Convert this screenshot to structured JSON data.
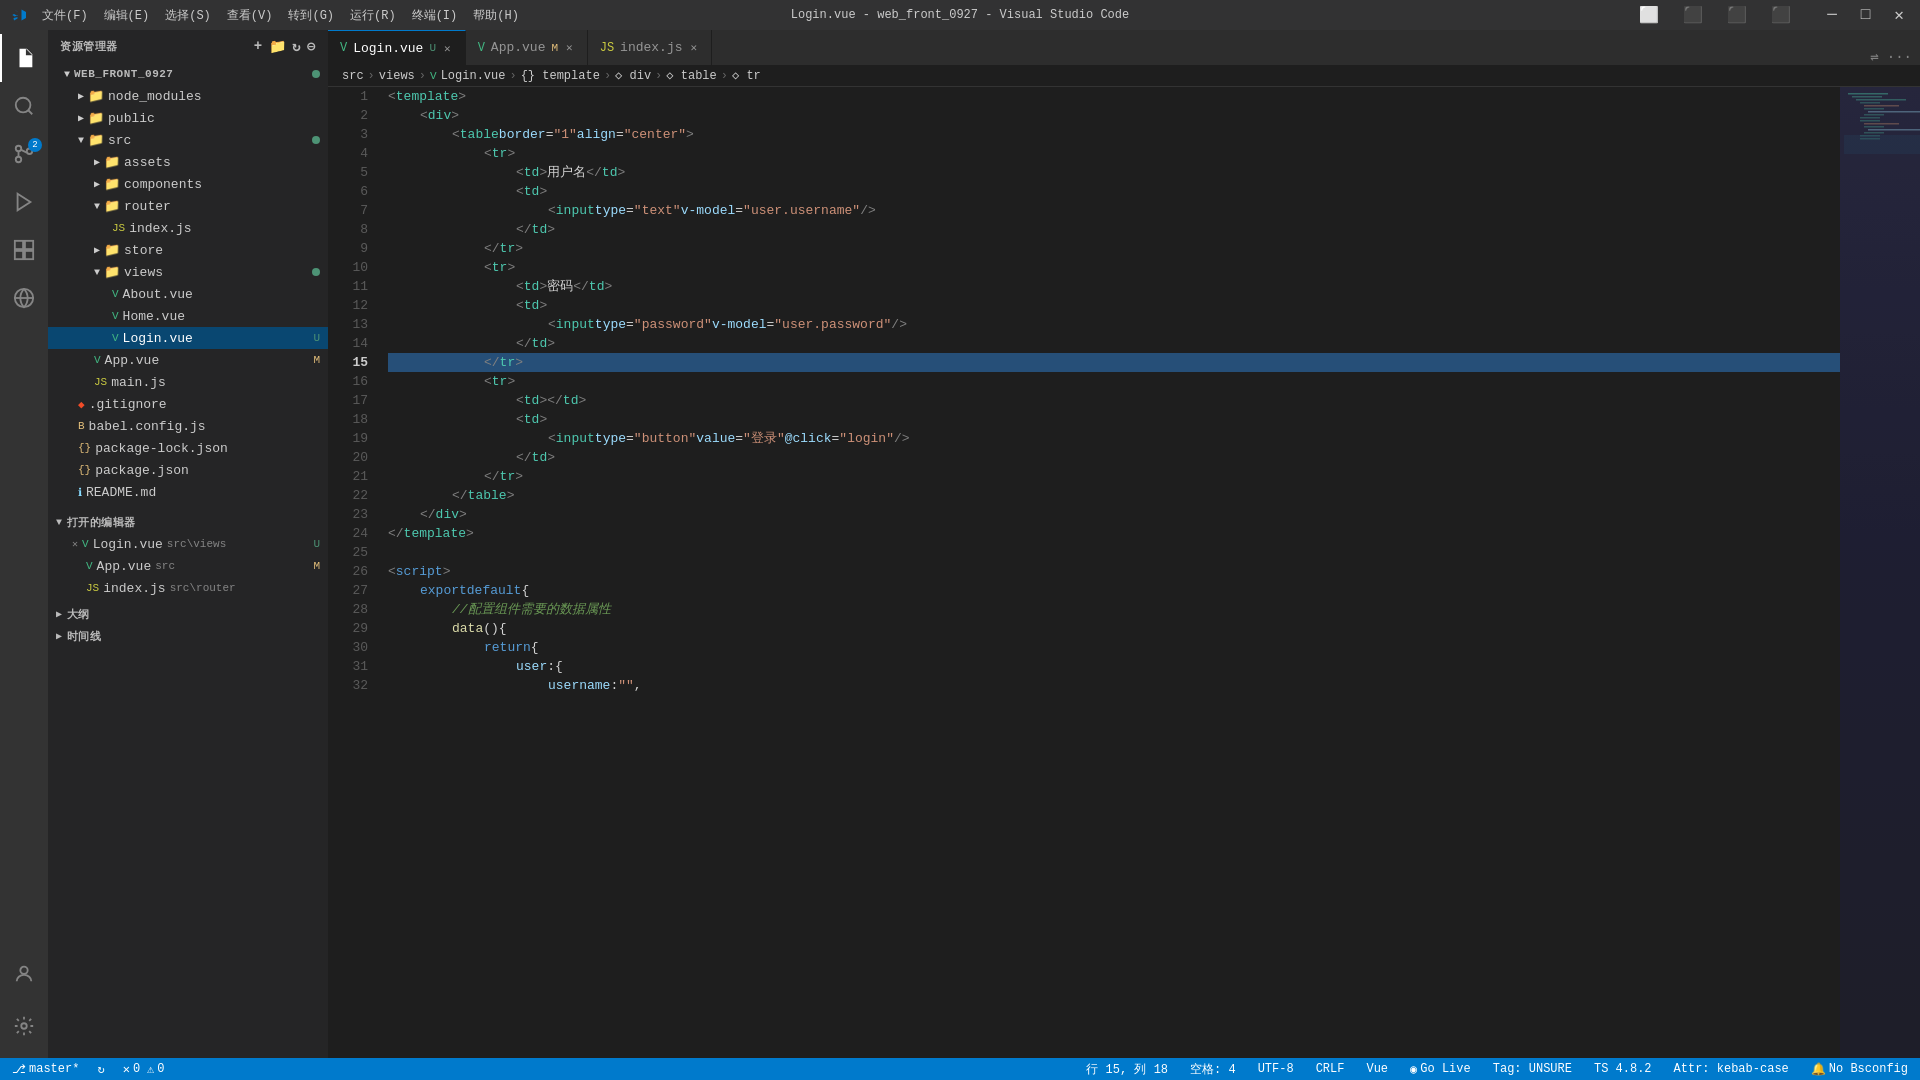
{
  "titleBar": {
    "menuItems": [
      "文件(F)",
      "编辑(E)",
      "选择(S)",
      "查看(V)",
      "转到(G)",
      "运行(R)",
      "终端(I)",
      "帮助(H)"
    ],
    "title": "Login.vue - web_front_0927 - Visual Studio Code"
  },
  "sidebar": {
    "header": "资源管理器",
    "rootName": "WEB_FRONT_0927",
    "openEditors": "打开的编辑器",
    "outline": "大纲",
    "timeline": "时间线",
    "files": [
      {
        "name": "node_modules",
        "type": "folder",
        "indent": 1,
        "collapsed": true
      },
      {
        "name": "public",
        "type": "folder",
        "indent": 1,
        "collapsed": true
      },
      {
        "name": "src",
        "type": "folder",
        "indent": 1,
        "collapsed": false,
        "dot": "modified"
      },
      {
        "name": "assets",
        "type": "folder",
        "indent": 2,
        "collapsed": true
      },
      {
        "name": "components",
        "type": "folder",
        "indent": 2,
        "collapsed": true
      },
      {
        "name": "router",
        "type": "folder",
        "indent": 2,
        "collapsed": false
      },
      {
        "name": "index.js",
        "type": "js",
        "indent": 3
      },
      {
        "name": "store",
        "type": "folder",
        "indent": 2,
        "collapsed": true
      },
      {
        "name": "views",
        "type": "folder",
        "indent": 2,
        "collapsed": false,
        "dot": "modified"
      },
      {
        "name": "About.vue",
        "type": "vue",
        "indent": 3
      },
      {
        "name": "Home.vue",
        "type": "vue",
        "indent": 3
      },
      {
        "name": "Login.vue",
        "type": "vue",
        "indent": 3,
        "active": true,
        "badge": "U"
      },
      {
        "name": "App.vue",
        "type": "vue",
        "indent": 2,
        "badge": "M"
      },
      {
        "name": "main.js",
        "type": "js",
        "indent": 2
      },
      {
        "name": ".gitignore",
        "type": "git",
        "indent": 1
      },
      {
        "name": "babel.config.js",
        "type": "js",
        "indent": 1
      },
      {
        "name": "package-lock.json",
        "type": "json",
        "indent": 1
      },
      {
        "name": "package.json",
        "type": "json",
        "indent": 1
      },
      {
        "name": "README.md",
        "type": "readme",
        "indent": 1
      }
    ],
    "openEditorFiles": [
      {
        "name": "Login.vue",
        "path": "src\\views",
        "badge": "U"
      },
      {
        "name": "App.vue",
        "path": "src",
        "badge": "M"
      },
      {
        "name": "index.js",
        "path": "src\\router"
      }
    ]
  },
  "tabs": [
    {
      "name": "Login.vue",
      "type": "vue",
      "active": true,
      "modified": true,
      "badge": "U"
    },
    {
      "name": "App.vue",
      "type": "vue",
      "active": false,
      "modified": true,
      "badge": "M"
    },
    {
      "name": "index.js",
      "type": "js",
      "active": false,
      "modified": false
    }
  ],
  "breadcrumb": {
    "items": [
      "src",
      "views",
      "Login.vue",
      "{} template",
      "div",
      "table",
      "tr"
    ]
  },
  "editor": {
    "lines": [
      {
        "num": 1,
        "content": "<template>"
      },
      {
        "num": 2,
        "content": "    <div>"
      },
      {
        "num": 3,
        "content": "        <table border=\"1\" align=\"center\">"
      },
      {
        "num": 4,
        "content": "            <tr>"
      },
      {
        "num": 5,
        "content": "                <td>用户名</td>"
      },
      {
        "num": 6,
        "content": "                <td>"
      },
      {
        "num": 7,
        "content": "                    <input type=\"text\" v-model=\"user.username\" />"
      },
      {
        "num": 8,
        "content": "                </td>"
      },
      {
        "num": 9,
        "content": "            </tr>"
      },
      {
        "num": 10,
        "content": "            <tr>"
      },
      {
        "num": 11,
        "content": "                <td>密码</td>"
      },
      {
        "num": 12,
        "content": "                <td>"
      },
      {
        "num": 13,
        "content": "                    <input type=\"password\" v-model=\"user.password\" />"
      },
      {
        "num": 14,
        "content": "                </td>"
      },
      {
        "num": 15,
        "content": "            </tr>",
        "highlighted": true
      },
      {
        "num": 16,
        "content": "            <tr>"
      },
      {
        "num": 17,
        "content": "                <td></td>"
      },
      {
        "num": 18,
        "content": "                <td>"
      },
      {
        "num": 19,
        "content": "                    <input type=\"button\" value=\"登录\" @click=\"login\" />"
      },
      {
        "num": 20,
        "content": "                </td>"
      },
      {
        "num": 21,
        "content": "            </tr>"
      },
      {
        "num": 22,
        "content": "        </table>"
      },
      {
        "num": 23,
        "content": "    </div>"
      },
      {
        "num": 24,
        "content": "</template>"
      },
      {
        "num": 25,
        "content": ""
      },
      {
        "num": 26,
        "content": "<script>"
      },
      {
        "num": 27,
        "content": "export default{"
      },
      {
        "num": 28,
        "content": "    //配置组件需要的数据属性"
      },
      {
        "num": 29,
        "content": "    data(){"
      },
      {
        "num": 30,
        "content": "        return{"
      },
      {
        "num": 31,
        "content": "            user:{"
      },
      {
        "num": 32,
        "content": "                username:\"\","
      }
    ]
  },
  "statusBar": {
    "branch": "master*",
    "errors": "0",
    "warnings": "0",
    "position": "行 15, 列 18",
    "spaces": "空格: 4",
    "encoding": "UTF-8",
    "lineEnding": "CRLF",
    "language": "Vue",
    "goLive": "Go Live",
    "tag": "Tag: UNSURE",
    "ts": "TS 4.8.2",
    "attr": "Attr: kebab-case",
    "notifText": "No Bsconfig"
  }
}
